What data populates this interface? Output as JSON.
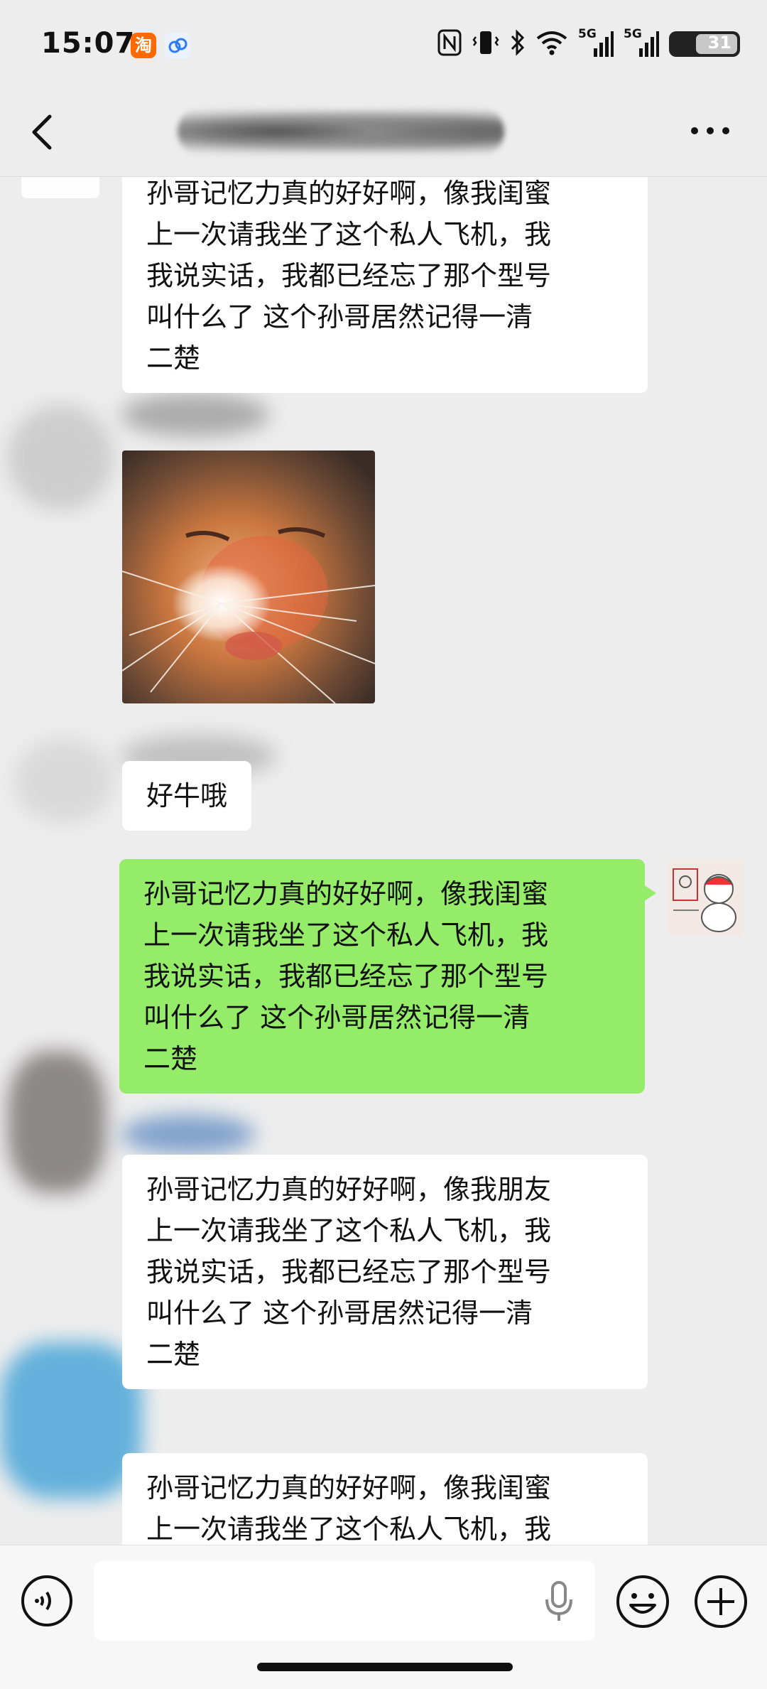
{
  "status_bar": {
    "time": "15:07",
    "taobao_badge": "淘",
    "signal_1": "5G",
    "signal_2": "5G",
    "battery": "31"
  },
  "nav": {
    "title": "",
    "back_icon": "chevron-left-icon",
    "more_icon": "more-horizontal-icon"
  },
  "messages": [
    {
      "side": "left",
      "kind": "text",
      "lines": [
        "孙哥记忆力真的好好啊，像我闺蜜",
        "上一次请我坐了这个私人飞机，我",
        "我说实话，我都已经忘了那个型号",
        "叫什么了 这个孙哥居然记得一清",
        "二楚"
      ]
    },
    {
      "side": "left",
      "kind": "image",
      "image": "cat-meme"
    },
    {
      "side": "left",
      "kind": "text",
      "lines": [
        "好牛哦"
      ]
    },
    {
      "side": "right",
      "kind": "text",
      "lines": [
        "孙哥记忆力真的好好啊，像我闺蜜",
        "上一次请我坐了这个私人飞机，我",
        "我说实话，我都已经忘了那个型号",
        "叫什么了 这个孙哥居然记得一清",
        "二楚"
      ]
    },
    {
      "side": "left",
      "kind": "text",
      "lines": [
        "孙哥记忆力真的好好啊，像我朋友",
        "上一次请我坐了这个私人飞机，我",
        "我说实话，我都已经忘了那个型号",
        "叫什么了 这个孙哥居然记得一清",
        "二楚"
      ]
    },
    {
      "side": "left",
      "kind": "text",
      "lines": [
        "孙哥记忆力真的好好啊，像我闺蜜",
        "上一次请我坐了这个私人飞机，我"
      ]
    }
  ],
  "input_bar": {
    "placeholder": "",
    "voice_icon": "voice-icon",
    "mic_icon": "microphone-icon",
    "emoji_icon": "emoji-icon",
    "plus_icon": "plus-icon"
  },
  "colors": {
    "background": "#ededed",
    "bubble_left": "#ffffff",
    "bubble_right": "#95ec69"
  }
}
